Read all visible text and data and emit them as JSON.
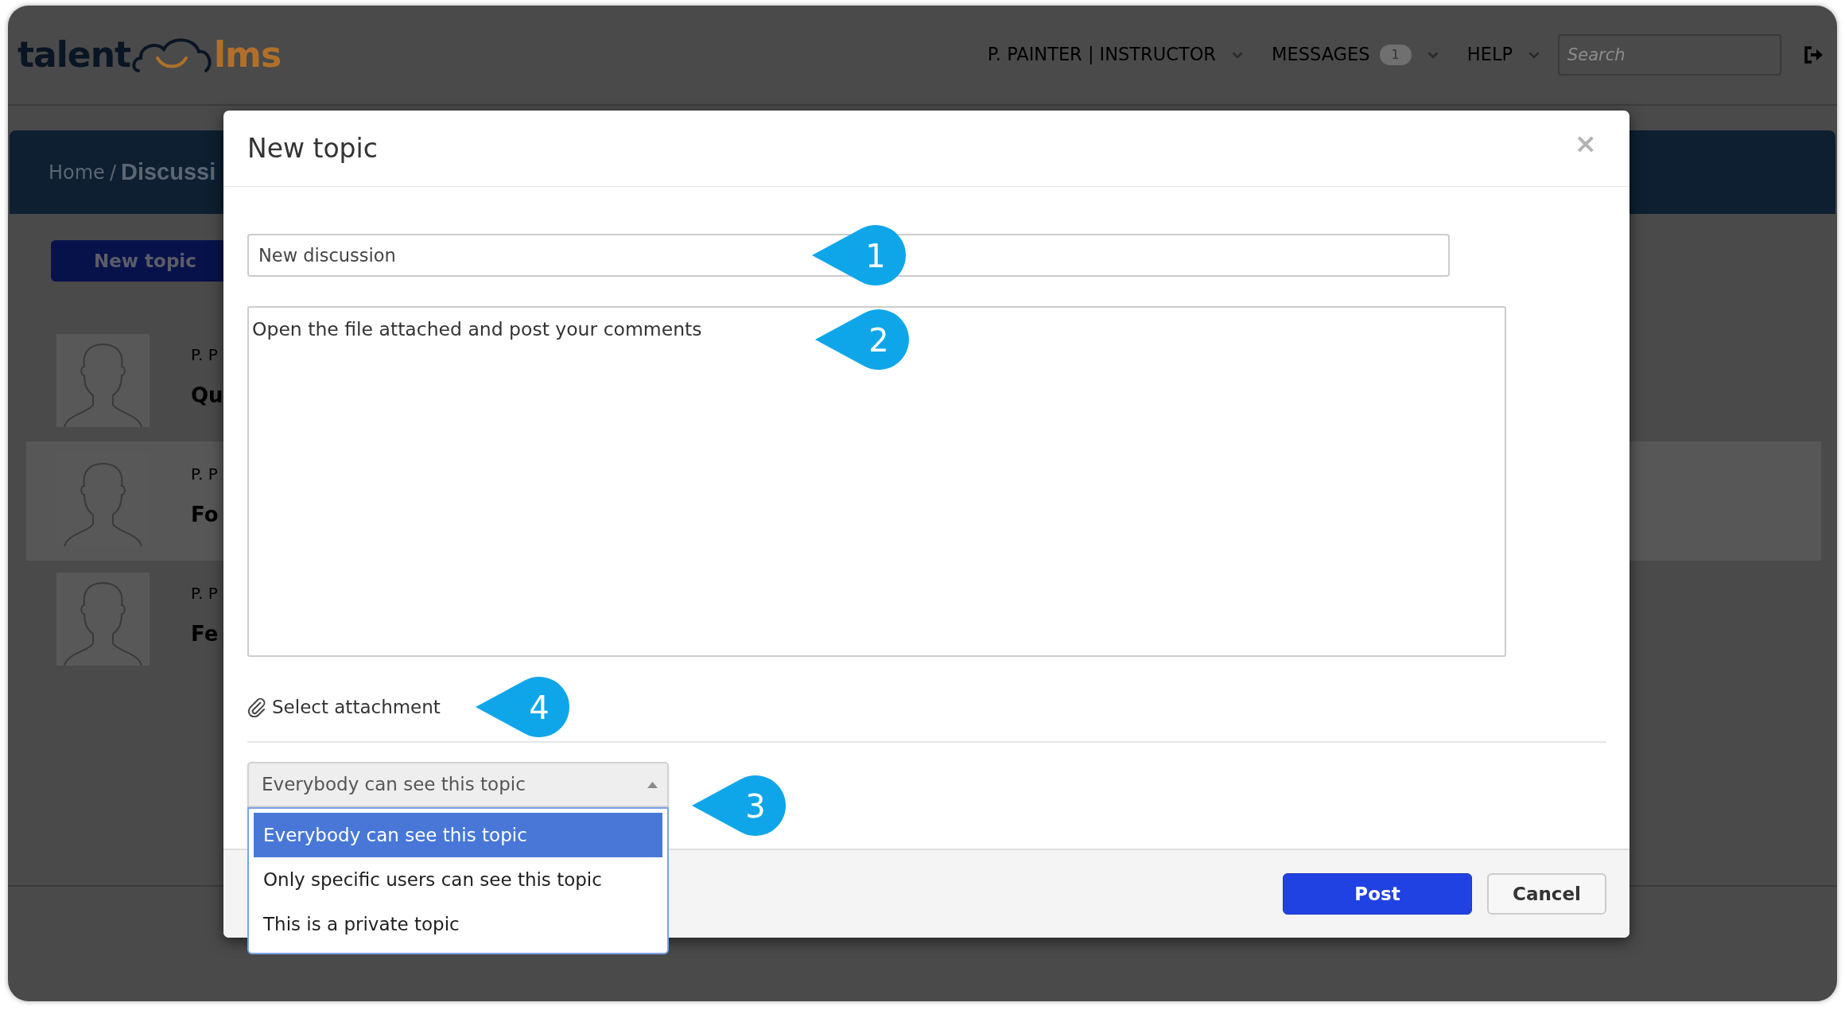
{
  "header": {
    "logo": {
      "left_text": "talent",
      "right_text": "lms"
    },
    "nav": [
      {
        "label": "P. PAINTER | INSTRUCTOR"
      },
      {
        "label": "MESSAGES",
        "badge": "1"
      },
      {
        "label": "HELP"
      }
    ],
    "search": {
      "placeholder": "Search"
    }
  },
  "breadcrumb": {
    "items": [
      "Home",
      "Discussi"
    ],
    "separator": "/"
  },
  "new_topic_button": {
    "label": "New topic"
  },
  "topics": [
    {
      "author": "P. P",
      "title": "Qu",
      "highlighted": false
    },
    {
      "author": "P. P",
      "title": "Fo",
      "highlighted": true
    },
    {
      "author": "P. P",
      "title": "Fe",
      "highlighted": false
    }
  ],
  "dialog": {
    "title": "New topic",
    "close_symbol": "×",
    "title_field": {
      "value": "New discussion",
      "callout": "1"
    },
    "message_field": {
      "value": "Open the file attached and post your comments",
      "callout": "2"
    },
    "attachment_link": {
      "label": "Select attachment",
      "callout": "4"
    },
    "visibility_select": {
      "value": "Everybody can see this topic",
      "expanded": true,
      "callout": "3",
      "options": [
        {
          "label": "Everybody can see this topic",
          "selected": true
        },
        {
          "label": "Only specific users can see this topic",
          "selected": false
        },
        {
          "label": "This is a private topic",
          "selected": false
        }
      ]
    },
    "buttons": [
      {
        "label": "Post",
        "kind": "primary"
      },
      {
        "label": "Cancel",
        "kind": "secondary"
      }
    ]
  }
}
